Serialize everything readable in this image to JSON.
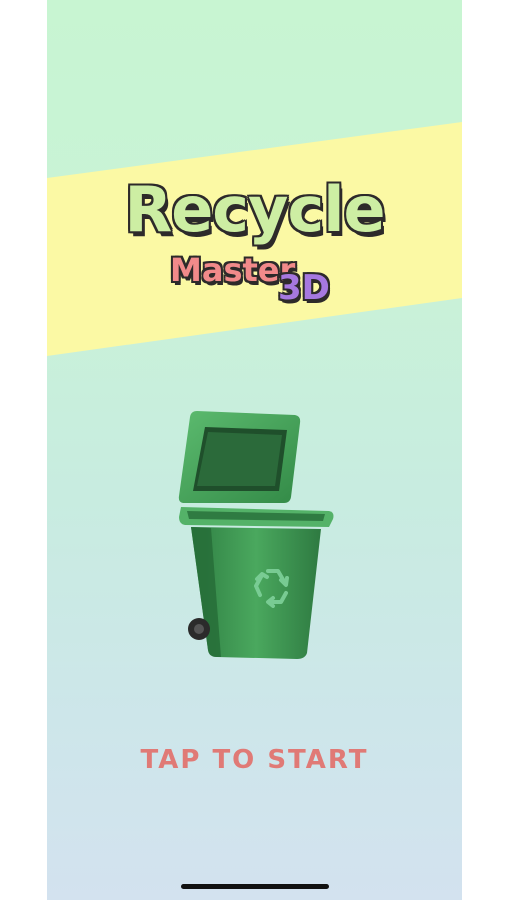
{
  "logo": {
    "title": "Recycle",
    "subtitle": "Master",
    "suffix": "3D"
  },
  "prompt": {
    "label": "TAP TO START"
  },
  "icons": {
    "bin": "recycling-bin-icon",
    "recycle_symbol": "recycle-symbol-icon"
  },
  "colors": {
    "background_top": "#c8f5d2",
    "background_bottom": "#d3e2ef",
    "banner": "#fbf9a4",
    "title_fill": "#cdeea3",
    "subtitle_fill": "#f18a8a",
    "suffix_fill": "#a678e0",
    "prompt_text": "#e07a76",
    "bin_green": "#3f9b53"
  }
}
